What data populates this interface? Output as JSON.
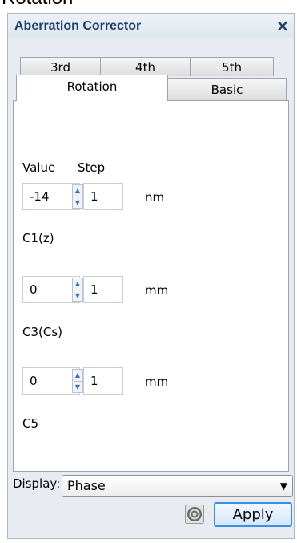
{
  "caption": "Rotation",
  "panel": {
    "title": "Aberration Corrector",
    "close_label": "×"
  },
  "tabs": {
    "row1": [
      "3rd",
      "4th",
      "5th"
    ],
    "row2": [
      "Rotation",
      "Basic"
    ],
    "selected": "Rotation"
  },
  "columns": {
    "value": "Value",
    "step": "Step"
  },
  "params": [
    {
      "name": "C1(z)",
      "value": "-14",
      "step": "1",
      "unit": "nm"
    },
    {
      "name": "C3(Cs)",
      "value": "0",
      "step": "1",
      "unit": "mm"
    },
    {
      "name": "C5",
      "value": "0",
      "step": "1",
      "unit": "mm"
    }
  ],
  "display": {
    "label": "Display:",
    "selected": "Phase"
  },
  "apply_label": "Apply",
  "icons": {
    "close": "close-icon",
    "spin_up": "spin-up-icon",
    "spin_down": "spin-down-icon",
    "chevron": "chevron-down-icon",
    "target": "target-icon"
  },
  "colors": {
    "title": "#1f3f6b",
    "apply_border": "#3b8ee0",
    "spin_arrow": "#3a6fbf"
  }
}
